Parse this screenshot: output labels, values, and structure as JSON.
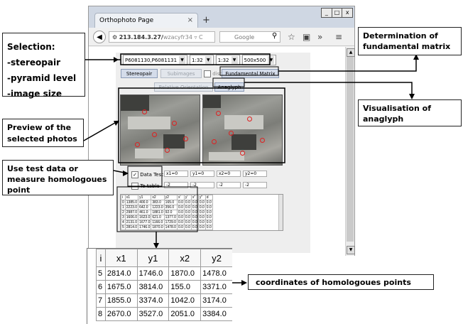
{
  "browser": {
    "tab_title": "Orthophoto Page",
    "tab_close": "×",
    "new_tab": "+",
    "window_controls": [
      "_",
      "□",
      "x"
    ],
    "url": "213.184.3.27/",
    "url_rest": "wzacyfr34",
    "search_placeholder": "Google",
    "search_badge": "8"
  },
  "app": {
    "selects": [
      {
        "value": "P6081130,P6081131"
      },
      {
        "value": "1:32"
      },
      {
        "value": "1:32"
      },
      {
        "value": "500x500"
      }
    ],
    "buttons_row1": {
      "stereopair": "Stereopair",
      "subimages": "Subimages",
      "dist": "dist",
      "fundamental": "Fundamental Matrix"
    },
    "buttons_row2": {
      "relative": "Relative Orientation",
      "anaglyph": "Anaglyph"
    },
    "data_test": {
      "label": "Data Test",
      "checked": true
    },
    "to_table": {
      "label": "To table",
      "checked": false
    },
    "coord_inputs": [
      "x1=0",
      "y1=0",
      "x2=0",
      "y2=0"
    ],
    "coord_values": [
      "-2",
      "-2",
      "-2",
      "-2"
    ],
    "table": {
      "headers": [
        "i",
        "x1",
        "y1",
        "x2",
        "y2",
        "x'",
        "y'",
        "x''",
        "y''",
        "d"
      ],
      "rows": [
        [
          "0",
          "1385.0",
          "400.0",
          "383.0",
          "165.0",
          "0.0",
          "0.0",
          "0.0",
          "0.0",
          "0.0"
        ],
        [
          "1",
          "2223.0",
          "642.0",
          "1223.0",
          "356.0",
          "0.0",
          "0.0",
          "0.0",
          "0.0",
          "0.0"
        ],
        [
          "2",
          "2987.0",
          "461.0",
          "1881.0",
          "92.0",
          "0.0",
          "0.0",
          "0.0",
          "0.0",
          "0.0"
        ],
        [
          "3",
          "1606.0",
          "1623.0",
          "621.0",
          "1377.0",
          "0.0",
          "0.0",
          "0.0",
          "0.0",
          "0.0"
        ],
        [
          "4",
          "2131.0",
          "1677.0",
          "1166.0",
          "1729.0",
          "0.0",
          "0.0",
          "0.0",
          "0.0",
          "0.0"
        ],
        [
          "5",
          "2814.0",
          "1746.0",
          "1870.0",
          "1478.0",
          "0.0",
          "0.0",
          "0.0",
          "0.0",
          "0.0"
        ]
      ]
    }
  },
  "annotations": {
    "selection": {
      "title": "Selection:",
      "items": [
        "-stereopair",
        "-pyramid level",
        "-image size"
      ]
    },
    "fundamental": "Determination of fundamental matrix",
    "anaglyph": "Visualisation of anaglyph",
    "preview": "Preview of the selected photos",
    "testdata": "Use test data or measure homologoues point",
    "coords": "coordinates of homologoues points"
  },
  "zoom_table": {
    "headers": [
      "i",
      "x1",
      "y1",
      "x2",
      "y2"
    ],
    "rows": [
      [
        "5",
        "2814.0",
        "1746.0",
        "1870.0",
        "1478.0"
      ],
      [
        "6",
        "1675.0",
        "3814.0",
        "155.0",
        "3371.0"
      ],
      [
        "7",
        "1855.0",
        "3374.0",
        "1042.0",
        "3174.0"
      ],
      [
        "8",
        "2670.0",
        "3527.0",
        "2051.0",
        "3384.0"
      ]
    ]
  }
}
